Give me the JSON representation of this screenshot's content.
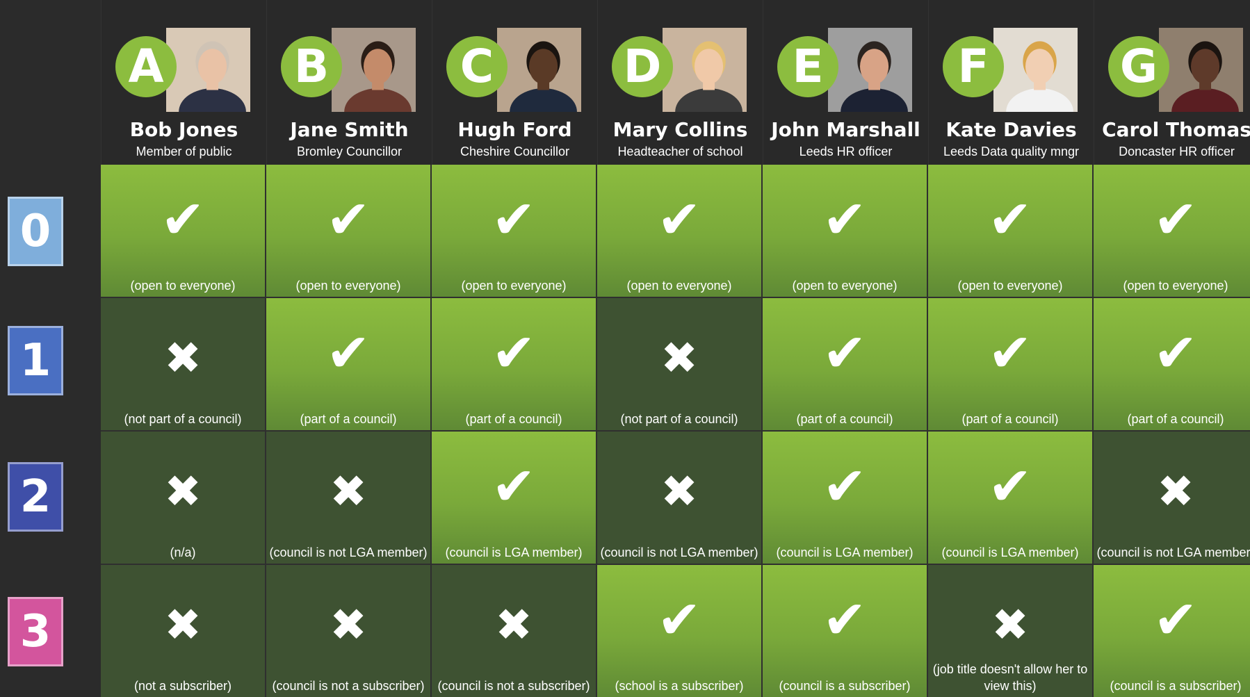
{
  "colors": {
    "background": "#2b2b2b",
    "accent_green": "#8cbd3f",
    "allowed_cell": "#7aa93a",
    "denied_cell": "#3e5232",
    "level_0": "#7faedb",
    "level_1": "#4a6fc2",
    "level_2": "#3f4fa8",
    "level_3": "#d3559d"
  },
  "people": [
    {
      "letter": "A",
      "name": "Bob Jones",
      "role": "Member of public",
      "photo": "portrait-photo"
    },
    {
      "letter": "B",
      "name": "Jane Smith",
      "role": "Bromley Councillor",
      "photo": "portrait-photo"
    },
    {
      "letter": "C",
      "name": "Hugh Ford",
      "role": "Cheshire Councillor",
      "photo": "portrait-photo"
    },
    {
      "letter": "D",
      "name": "Mary Collins",
      "role": "Headteacher of school",
      "photo": "portrait-photo"
    },
    {
      "letter": "E",
      "name": "John Marshall",
      "role": "Leeds HR officer",
      "photo": "portrait-photo"
    },
    {
      "letter": "F",
      "name": "Kate Davies",
      "role": "Leeds Data quality mngr",
      "photo": "portrait-photo"
    },
    {
      "letter": "G",
      "name": "Carol Thomas",
      "role": "Doncaster HR officer",
      "photo": "portrait-photo"
    }
  ],
  "levels": [
    {
      "label": "0",
      "cells": [
        {
          "allowed": true,
          "mark": "✔",
          "note": "(open to everyone)"
        },
        {
          "allowed": true,
          "mark": "✔",
          "note": "(open to everyone)"
        },
        {
          "allowed": true,
          "mark": "✔",
          "note": "(open to everyone)"
        },
        {
          "allowed": true,
          "mark": "✔",
          "note": "(open to everyone)"
        },
        {
          "allowed": true,
          "mark": "✔",
          "note": "(open to everyone)"
        },
        {
          "allowed": true,
          "mark": "✔",
          "note": "(open to everyone)"
        },
        {
          "allowed": true,
          "mark": "✔",
          "note": "(open to everyone)"
        }
      ]
    },
    {
      "label": "1",
      "cells": [
        {
          "allowed": false,
          "mark": "✖",
          "note": "(not part of a council)"
        },
        {
          "allowed": true,
          "mark": "✔",
          "note": "(part of a council)"
        },
        {
          "allowed": true,
          "mark": "✔",
          "note": "(part of a council)"
        },
        {
          "allowed": false,
          "mark": "✖",
          "note": "(not part of a council)"
        },
        {
          "allowed": true,
          "mark": "✔",
          "note": "(part of a council)"
        },
        {
          "allowed": true,
          "mark": "✔",
          "note": "(part of a council)"
        },
        {
          "allowed": true,
          "mark": "✔",
          "note": "(part of a council)"
        }
      ]
    },
    {
      "label": "2",
      "cells": [
        {
          "allowed": false,
          "mark": "✖",
          "note": "(n/a)"
        },
        {
          "allowed": false,
          "mark": "✖",
          "note": "(council is not LGA member)"
        },
        {
          "allowed": true,
          "mark": "✔",
          "note": "(council is LGA member)"
        },
        {
          "allowed": false,
          "mark": "✖",
          "note": "(council is not LGA member)"
        },
        {
          "allowed": true,
          "mark": "✔",
          "note": "(council is LGA member)"
        },
        {
          "allowed": true,
          "mark": "✔",
          "note": "(council is LGA member)"
        },
        {
          "allowed": false,
          "mark": "✖",
          "note": "(council is not LGA member)"
        }
      ]
    },
    {
      "label": "3",
      "cells": [
        {
          "allowed": false,
          "mark": "✖",
          "note": "(not a subscriber)"
        },
        {
          "allowed": false,
          "mark": "✖",
          "note": "(council is not a subscriber)"
        },
        {
          "allowed": false,
          "mark": "✖",
          "note": "(council is not a subscriber)"
        },
        {
          "allowed": true,
          "mark": "✔",
          "note": "(school is a subscriber)"
        },
        {
          "allowed": true,
          "mark": "✔",
          "note": "(council is a subscriber)"
        },
        {
          "allowed": false,
          "mark": "✖",
          "note": "(job title doesn't allow her to view this)"
        },
        {
          "allowed": true,
          "mark": "✔",
          "note": "(council is a subscriber)"
        }
      ]
    }
  ]
}
